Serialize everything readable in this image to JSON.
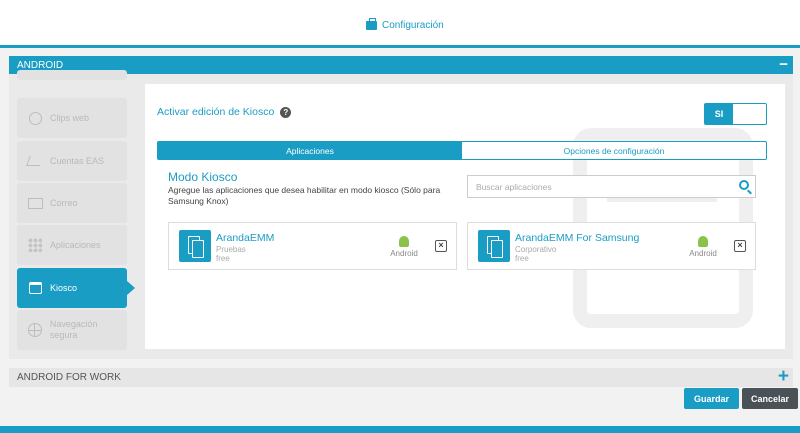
{
  "header": {
    "title": "Configuración",
    "icon": "briefcase-icon"
  },
  "section_android": {
    "title": "ANDROID",
    "toggle": "−"
  },
  "sidebar": {
    "items": [
      {
        "label": "Clips web",
        "icon": "web-clip-icon"
      },
      {
        "label": "Cuentas EAS",
        "icon": "eas-accounts-icon"
      },
      {
        "label": "Correo",
        "icon": "mail-icon"
      },
      {
        "label": "Aplicaciones",
        "icon": "apps-grid-icon"
      },
      {
        "label": "Kiosco",
        "icon": "kiosk-icon",
        "active": true
      },
      {
        "label": "Navegación segura",
        "icon": "globe-icon"
      }
    ]
  },
  "kiosk": {
    "label": "Activar edición de Kiosco",
    "help": "?",
    "switch_label": "SI",
    "tabs": [
      "Aplicaciones",
      "Opciones de configuración"
    ],
    "modo_title": "Modo Kiosco",
    "modo_desc": "Agregue las aplicaciones que desea habilitar en modo kiosco (Sólo para Samsung Knox)",
    "search_placeholder": "Buscar aplicaciones",
    "apps": [
      {
        "name": "ArandaEMM",
        "group": "Pruebas",
        "price": "free",
        "platform": "Android",
        "remove": "×"
      },
      {
        "name": "ArandaEMM For Samsung",
        "group": "Corporativo",
        "price": "free",
        "platform": "Android",
        "remove": "×"
      }
    ]
  },
  "section_work": {
    "title": "ANDROID FOR WORK",
    "toggle": "+"
  },
  "actions": {
    "save": "Guardar",
    "cancel": "Cancelar"
  },
  "colors": {
    "accent": "#1a9dc4",
    "cancel": "#4a5258"
  }
}
